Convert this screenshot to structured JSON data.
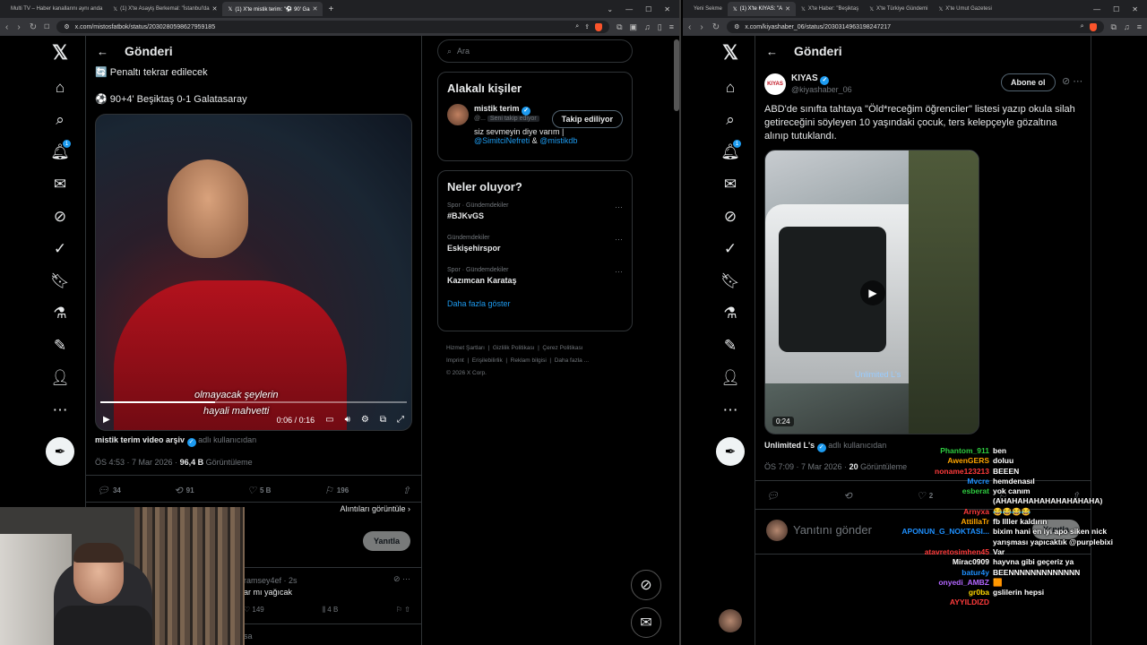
{
  "left_browser": {
    "tabs": [
      {
        "label": "Multi TV – Haber kanallarını aynı anda",
        "active": false
      },
      {
        "label": "(1) X'te Asayiş Berkemal: \"İstanbul'da",
        "active": false
      },
      {
        "label": "(1) X'te mistik terim: \"⚽ 90' Ga",
        "active": true
      }
    ],
    "new_tab": "+",
    "url": "x.com/mistosfatbok/status/2030280598627959185",
    "header_title": "Gönderi",
    "post": {
      "line1": "🔄 Penaltı tekrar edilecek",
      "line2": "⚽ 90+4' Beşiktaş 0-1 Galatasaray",
      "subtitle1": "olmayacak şeylerin",
      "subtitle2": "hayali mahvetti",
      "video_time": "0:06 / 0:16",
      "source_name": "mistik terim video arşiv",
      "source_suffix": "adlı kullanıcıdan",
      "time": "ÖS 4:53 · 7 Mar 2026 ·",
      "views_count": "96,4 B",
      "views_label": "Görüntüleme",
      "replies": "34",
      "reposts": "91",
      "likes": "5 B",
      "bookmarks": "196",
      "quotes_link": "Alıntıları görüntüle",
      "reply_button": "Yanıtla"
    },
    "reply": {
      "handle": "ramsey4ef · 2s",
      "text": "ar mı yağıcak",
      "likes": "149",
      "views": "4 B",
      "partial": "sa"
    },
    "search_placeholder": "Ara",
    "related": {
      "title": "Alakalı kişiler",
      "name": "mistik terim",
      "handle": "@...",
      "follows_you": "Seni takip ediyor",
      "follow_button": "Takip ediliyor",
      "bio": "siz sevmeyin diye varım |",
      "bio_mention1": "@SimitciNefreti",
      "bio_and": "&",
      "bio_mention2": "@mistikdb"
    },
    "trends": {
      "title": "Neler oluyor?",
      "items": [
        {
          "category": "Spor · Gündemdekiler",
          "topic": "#BJKvGS"
        },
        {
          "category": "Gündemdekiler",
          "topic": "Eskişehirspor"
        },
        {
          "category": "Spor · Gündemdekiler",
          "topic": "Kazımcan Karataş"
        }
      ],
      "show_more": "Daha fazla göster"
    },
    "footer": [
      "Hizmet Şartları",
      "Gizlilik Politikası",
      "Çerez Politikası",
      "Imprint",
      "Erişilebilirlik",
      "Reklam bilgisi",
      "Daha fazla ...",
      "© 2026 X Corp."
    ]
  },
  "right_browser": {
    "tabs": [
      {
        "label": "Yeni Sekme",
        "active": false
      },
      {
        "label": "(1) X'te KIYAS: \"A",
        "active": true
      },
      {
        "label": "X'te Haber: \"Beşiktaş",
        "active": false
      },
      {
        "label": "X'te Türkiye Gündemi",
        "active": false
      },
      {
        "label": "X'te Umut Gazetesi",
        "active": false
      }
    ],
    "url": "x.com/kiyashaber_06/status/2030314963198247217",
    "header_title": "Gönderi",
    "post": {
      "avatar_text": "KIYAS",
      "name": "KIYAS",
      "handle": "@kiyashaber_06",
      "subscribe": "Abone ol",
      "text": "ABD'de sınıfta tahtaya \"Öld*receğim öğrenciler\" listesi yazıp okula silah getireceğini söyleyen 10 yaşındaki çocuk, ters kelepçeyle gözaltına alınıp tutuklandı.",
      "watermark": "Unlimited L's",
      "duration": "0:24",
      "source_name": "Unlimited L's",
      "source_suffix": "adlı kullanıcıdan",
      "time": "ÖS 7:09 · 7 Mar 2026 ·",
      "views_count": "20",
      "views_label": "Görüntüleme",
      "likes": "2",
      "reply_placeholder": "Yanıtını gönder",
      "reply_button": "Yanıtla"
    }
  },
  "chat": [
    {
      "user": "Phantom_911",
      "color": "#2ecc40",
      "msg": "ben"
    },
    {
      "user": "AwenGERS",
      "color": "#ffa500",
      "msg": "doluu"
    },
    {
      "user": "noname123213",
      "color": "#ff3b3b",
      "msg": "BEEEN"
    },
    {
      "user": "Mvcre",
      "color": "#1e90ff",
      "msg": "hemdenasıl"
    },
    {
      "user": "esberat",
      "color": "#2ecc40",
      "msg": "yok canım"
    },
    {
      "user": "",
      "color": "#ffffff",
      "msg": "(AHAHAHAHAHAHAHAHAHA)"
    },
    {
      "user": "Arnyxa",
      "color": "#ff3b3b",
      "msg": "😂😂😂😂"
    },
    {
      "user": "AttillaTr",
      "color": "#ffa500",
      "msg": "fb llller kaldırın"
    },
    {
      "user": "APONUN_G_NOKTASI...",
      "color": "#1e90ff",
      "msg": "bixim hani en iyi apo siken nick"
    },
    {
      "user": "",
      "color": "#ffffff",
      "msg": "yarışması yapıcaktık @purplebixi"
    },
    {
      "user": "atavretosimhen45",
      "color": "#ff3b3b",
      "msg": "Var"
    },
    {
      "user": "Mirac0909",
      "color": "#ffffff",
      "msg": "hayvna gibi geçeriz ya"
    },
    {
      "user": "batur4y",
      "color": "#1e90ff",
      "msg": "BEENNNNNNNNNNNNN"
    },
    {
      "user": "onyedi_AMBZ",
      "color": "#b366ff",
      "msg": "🟧"
    },
    {
      "user": "gr0ba",
      "color": "#ffd700",
      "msg": "gslilerin hepsi"
    },
    {
      "user": "AYYILDIZD",
      "color": "#ff3b3b",
      "msg": ""
    }
  ]
}
